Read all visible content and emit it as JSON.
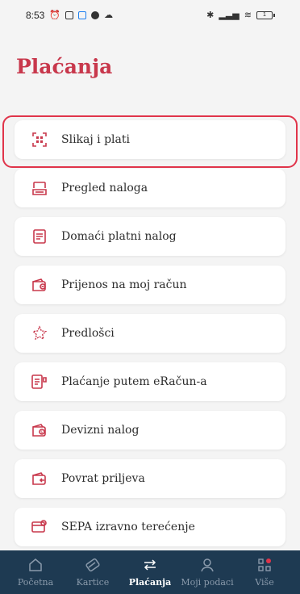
{
  "status_bar": {
    "time": "8:53",
    "battery": "1"
  },
  "header": {
    "title": "Plaćanja"
  },
  "menu": {
    "items": [
      {
        "label": "Slikaj i plati",
        "icon": "qr-scan-icon"
      },
      {
        "label": "Pregled naloga",
        "icon": "document-tray-icon"
      },
      {
        "label": "Domaći platni nalog",
        "icon": "document-icon"
      },
      {
        "label": "Prijenos na moj račun",
        "icon": "wallet-transfer-icon"
      },
      {
        "label": "Predlošci",
        "icon": "star-template-icon"
      },
      {
        "label": "Plaćanje putem eRačun-a",
        "icon": "einvoice-icon"
      },
      {
        "label": "Devizni nalog",
        "icon": "wallet-currency-icon"
      },
      {
        "label": "Povrat priljeva",
        "icon": "wallet-return-icon"
      },
      {
        "label": "SEPA izravno terećenje",
        "icon": "sepa-debit-icon"
      }
    ]
  },
  "tabbar": {
    "tabs": [
      {
        "label": "Početna",
        "icon": "home-icon"
      },
      {
        "label": "Kartice",
        "icon": "card-icon"
      },
      {
        "label": "Plaćanja",
        "icon": "transfer-arrows-icon",
        "active": true
      },
      {
        "label": "Moji podaci",
        "icon": "user-icon"
      },
      {
        "label": "Više",
        "icon": "grid-more-icon"
      }
    ]
  },
  "colors": {
    "accent": "#c8384c",
    "tabbar_bg": "#1e3a52",
    "highlight": "#e0344a"
  }
}
